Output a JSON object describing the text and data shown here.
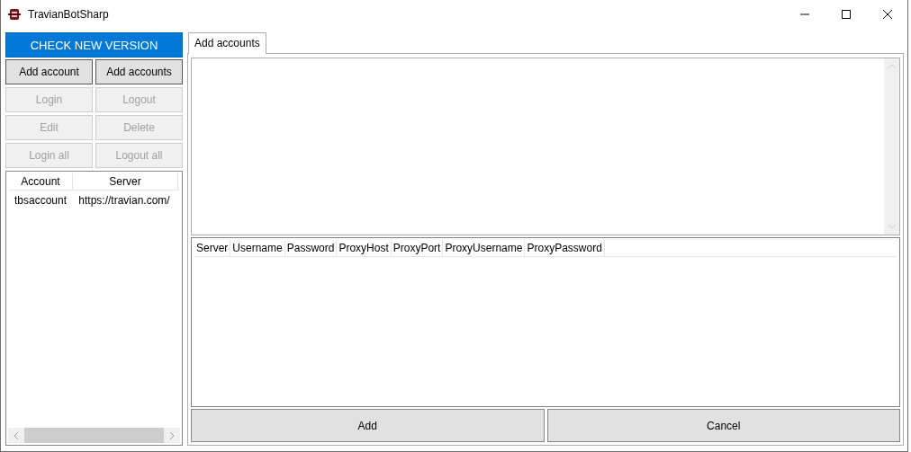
{
  "window": {
    "title": "TravianBotSharp"
  },
  "sidebar": {
    "update_button": {
      "label": "CHECK NEW VERSION"
    },
    "buttons": [
      {
        "label": "Add account",
        "disabled": false
      },
      {
        "label": "Add accounts",
        "disabled": false
      },
      {
        "label": "Login",
        "disabled": true
      },
      {
        "label": "Logout",
        "disabled": true
      },
      {
        "label": "Edit",
        "disabled": true
      },
      {
        "label": "Delete",
        "disabled": true
      },
      {
        "label": "Login all",
        "disabled": true
      },
      {
        "label": "Logout all",
        "disabled": true
      }
    ],
    "accounts_table": {
      "columns": [
        "Account",
        "Server"
      ],
      "rows": [
        [
          "tbsaccount",
          "https://travian.com/"
        ]
      ]
    }
  },
  "tabs": [
    {
      "label": "Add accounts",
      "selected": true
    }
  ],
  "accounts_grid": {
    "columns": [
      "Server",
      "Username",
      "Password",
      "ProxyHost",
      "ProxyPort",
      "ProxyUsername",
      "ProxyPassword"
    ]
  },
  "buttons": [
    {
      "label": "Add"
    },
    {
      "label": "Cancel"
    }
  ]
}
